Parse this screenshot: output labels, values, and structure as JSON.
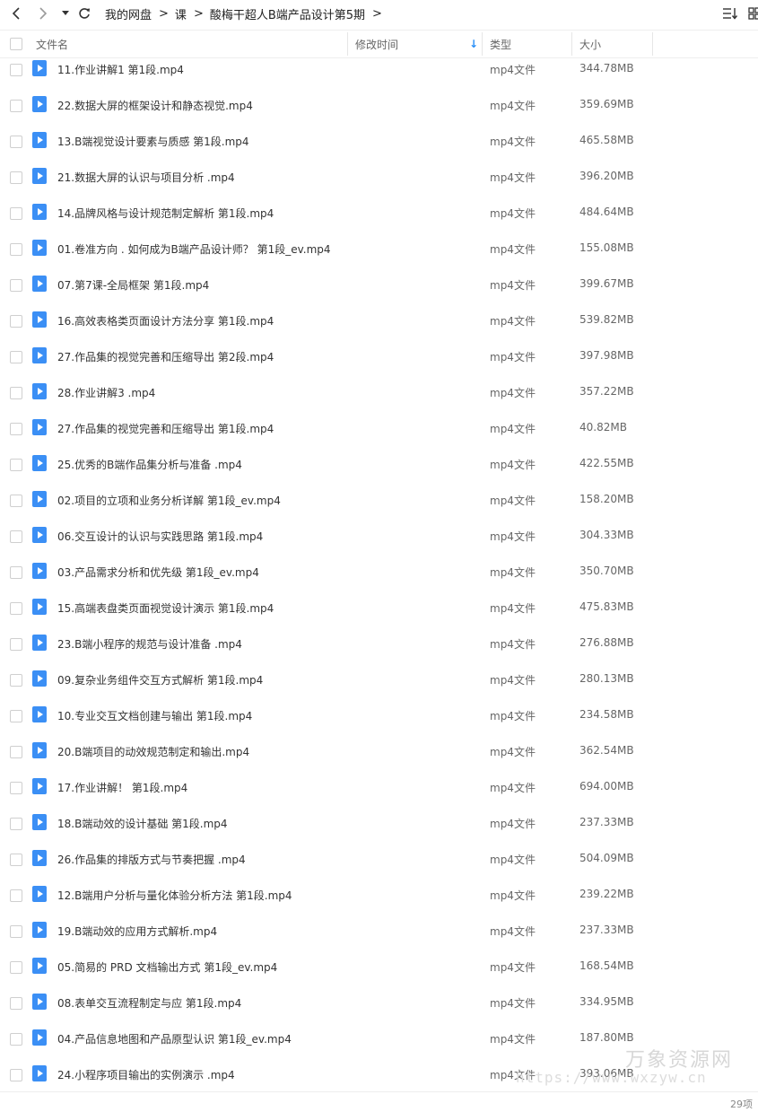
{
  "toolbar": {
    "back_icon": "chevron-left-icon",
    "forward_icon": "chevron-right-icon",
    "history_icon": "caret-down-icon",
    "refresh_icon": "refresh-icon",
    "breadcrumbs": [
      "我的网盘",
      "课",
      "酸梅干超人B端产品设计第5期"
    ],
    "sort_icon": "sort-list-icon",
    "view_icon": "grid-view-icon"
  },
  "columns": {
    "name": "文件名",
    "modified": "修改时间",
    "type": "类型",
    "size": "大小"
  },
  "files": [
    {
      "name": "11.作业讲解1 第1段.mp4",
      "type": "mp4文件",
      "size": "344.78MB"
    },
    {
      "name": "22.数据大屏的框架设计和静态视觉.mp4",
      "type": "mp4文件",
      "size": "359.69MB"
    },
    {
      "name": "13.B端视觉设计要素与质感 第1段.mp4",
      "type": "mp4文件",
      "size": "465.58MB"
    },
    {
      "name": "21.数据大屏的认识与项目分析 .mp4",
      "type": "mp4文件",
      "size": "396.20MB"
    },
    {
      "name": "14.品牌风格与设计规范制定解析 第1段.mp4",
      "type": "mp4文件",
      "size": "484.64MB"
    },
    {
      "name": "01.卷准方向 . 如何成为B端产品设计师？ 第1段_ev.mp4",
      "type": "mp4文件",
      "size": "155.08MB"
    },
    {
      "name": "07.第7课-全局框架 第1段.mp4",
      "type": "mp4文件",
      "size": "399.67MB"
    },
    {
      "name": "16.高效表格类页面设计方法分享 第1段.mp4",
      "type": "mp4文件",
      "size": "539.82MB"
    },
    {
      "name": "27.作品集的视觉完善和压缩导出 第2段.mp4",
      "type": "mp4文件",
      "size": "397.98MB"
    },
    {
      "name": "28.作业讲解3 .mp4",
      "type": "mp4文件",
      "size": "357.22MB"
    },
    {
      "name": "27.作品集的视觉完善和压缩导出 第1段.mp4",
      "type": "mp4文件",
      "size": "40.82MB"
    },
    {
      "name": "25.优秀的B端作品集分析与准备 .mp4",
      "type": "mp4文件",
      "size": "422.55MB"
    },
    {
      "name": "02.项目的立项和业务分析详解 第1段_ev.mp4",
      "type": "mp4文件",
      "size": "158.20MB"
    },
    {
      "name": "06.交互设计的认识与实践思路 第1段.mp4",
      "type": "mp4文件",
      "size": "304.33MB"
    },
    {
      "name": "03.产品需求分析和优先级 第1段_ev.mp4",
      "type": "mp4文件",
      "size": "350.70MB"
    },
    {
      "name": "15.高端表盘类页面视觉设计演示 第1段.mp4",
      "type": "mp4文件",
      "size": "475.83MB"
    },
    {
      "name": "23.B端小程序的规范与设计准备 .mp4",
      "type": "mp4文件",
      "size": "276.88MB"
    },
    {
      "name": "09.复杂业务组件交互方式解析 第1段.mp4",
      "type": "mp4文件",
      "size": "280.13MB"
    },
    {
      "name": "10.专业交互文档创建与输出 第1段.mp4",
      "type": "mp4文件",
      "size": "234.58MB"
    },
    {
      "name": "20.B端项目的动效规范制定和输出.mp4",
      "type": "mp4文件",
      "size": "362.54MB"
    },
    {
      "name": "17.作业讲解！ 第1段.mp4",
      "type": "mp4文件",
      "size": "694.00MB"
    },
    {
      "name": "18.B端动效的设计基础 第1段.mp4",
      "type": "mp4文件",
      "size": "237.33MB"
    },
    {
      "name": "26.作品集的排版方式与节奏把握 .mp4",
      "type": "mp4文件",
      "size": "504.09MB"
    },
    {
      "name": "12.B端用户分析与量化体验分析方法 第1段.mp4",
      "type": "mp4文件",
      "size": "239.22MB"
    },
    {
      "name": "19.B端动效的应用方式解析.mp4",
      "type": "mp4文件",
      "size": "237.33MB"
    },
    {
      "name": "05.简易的 PRD 文档输出方式 第1段_ev.mp4",
      "type": "mp4文件",
      "size": "168.54MB"
    },
    {
      "name": "08.表单交互流程制定与应 第1段.mp4",
      "type": "mp4文件",
      "size": "334.95MB"
    },
    {
      "name": "04.产品信息地图和产品原型认识 第1段_ev.mp4",
      "type": "mp4文件",
      "size": "187.80MB"
    },
    {
      "name": "24.小程序项目输出的实例演示 .mp4",
      "type": "mp4文件",
      "size": "393.06MB"
    }
  ],
  "watermark": {
    "title": "万象资源网",
    "url": "https://www.wxzyw.cn"
  },
  "footer": {
    "item_count": "29项"
  },
  "colors": {
    "accent": "#3b8ff5",
    "sort_indicator": "#2a8ff7"
  }
}
